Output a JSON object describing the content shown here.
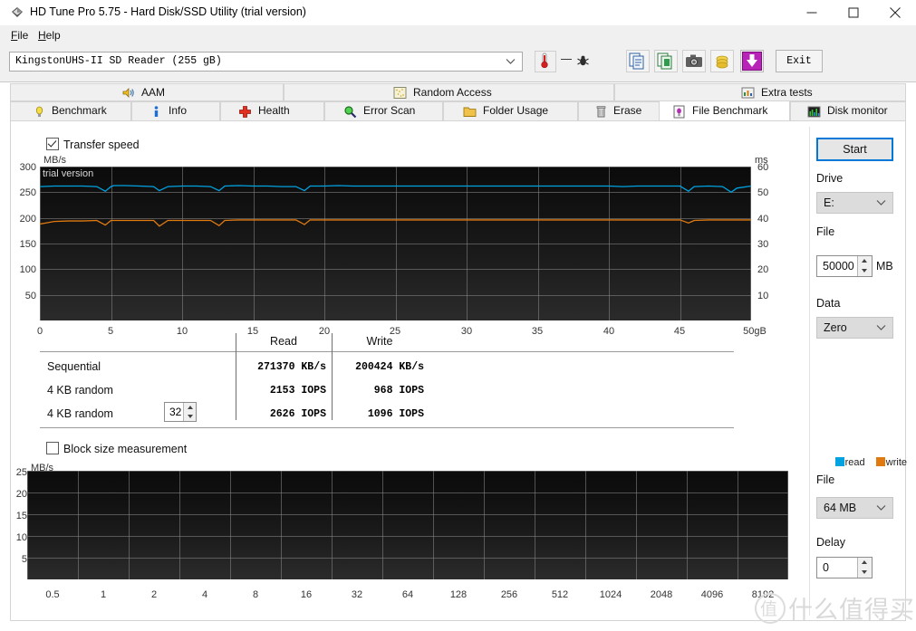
{
  "window": {
    "title": "HD Tune Pro 5.75 - Hard Disk/SSD Utility (trial version)",
    "minimize": "minimize-icon",
    "maximize": "maximize-icon",
    "close": "close-icon"
  },
  "menu": {
    "items": [
      "File",
      "Help"
    ]
  },
  "toolbar": {
    "drive_value": "KingstonUHS-II SD Reader  (255 gB)",
    "temperature": "—",
    "exit_label": "Exit",
    "buttons": [
      "copy-icon",
      "copy-excel-icon",
      "camera-icon",
      "folder-coins-icon",
      "download-icon"
    ]
  },
  "tabs_top": [
    {
      "label": "AAM",
      "icon": "speaker-icon"
    },
    {
      "label": "Random Access",
      "icon": "random-access-icon"
    },
    {
      "label": "Extra tests",
      "icon": "chart-icon"
    }
  ],
  "tabs_bottom": [
    {
      "label": "Benchmark",
      "icon": "bulb-icon",
      "active": false
    },
    {
      "label": "Info",
      "icon": "info-icon",
      "active": false
    },
    {
      "label": "Health",
      "icon": "cross-icon",
      "active": false
    },
    {
      "label": "Error Scan",
      "icon": "magnifier-icon",
      "active": false
    },
    {
      "label": "Folder Usage",
      "icon": "folder-icon",
      "active": false
    },
    {
      "label": "Erase",
      "icon": "trash-icon",
      "active": false
    },
    {
      "label": "File Benchmark",
      "icon": "file-benchmark-icon",
      "active": true
    },
    {
      "label": "Disk monitor",
      "icon": "monitor-chart-icon",
      "active": false
    }
  ],
  "transfer_speed": {
    "checkbox_label": "Transfer speed",
    "checked": true,
    "trial_tag": "trial version"
  },
  "block_size": {
    "checkbox_label": "Block size measurement",
    "checked": false
  },
  "legend": {
    "read": "read",
    "write": "write",
    "read_color": "#00a2e0",
    "write_color": "#e07a10"
  },
  "results": {
    "columns": [
      "",
      "Read",
      "Write"
    ],
    "rows": [
      {
        "label": "Sequential",
        "read": "271370 KB/s",
        "write": "200424 KB/s"
      },
      {
        "label": "4 KB random",
        "read": "2153 IOPS",
        "write": "968 IOPS"
      },
      {
        "label": "4 KB random",
        "read": "2626 IOPS",
        "write": "1096 IOPS",
        "queue_depth": "32"
      }
    ]
  },
  "right_panel": {
    "start_label": "Start",
    "drive_label": "Drive",
    "drive_value": "E:",
    "file_label": "File",
    "file_value": "50000",
    "file_unit": "MB",
    "data_label": "Data",
    "data_value": "Zero"
  },
  "right_panel_bottom": {
    "file_label": "File",
    "file_value": "64 MB",
    "delay_label": "Delay",
    "delay_value": "0"
  },
  "watermark": {
    "text": "什么值得买",
    "mark": "值"
  },
  "chart_data": [
    {
      "type": "line",
      "title": "Transfer speed",
      "ylabel": "MB/s",
      "y2label": "ms",
      "xlabel": "",
      "xlim": [
        0,
        50
      ],
      "ylim": [
        0,
        300
      ],
      "y2lim": [
        0,
        60
      ],
      "grid": true,
      "xticks": [
        "0",
        "5",
        "10",
        "15",
        "20",
        "25",
        "30",
        "35",
        "40",
        "45",
        "50gB"
      ],
      "yticks": [
        "50",
        "100",
        "150",
        "200",
        "250",
        "300"
      ],
      "y2ticks": [
        "10",
        "20",
        "30",
        "40",
        "50",
        "60"
      ],
      "legend": [
        "read",
        "write"
      ],
      "series": [
        {
          "name": "read",
          "color": "#00a2e0",
          "x": [
            0,
            1,
            2,
            3,
            4,
            4.6,
            5,
            5.2,
            6,
            7,
            8,
            8.4,
            9,
            10,
            11,
            12,
            12.6,
            13,
            14,
            15,
            16,
            17,
            18,
            18.6,
            19,
            20,
            21,
            22,
            23,
            24,
            25,
            26,
            27,
            28,
            29,
            30,
            31,
            32,
            33,
            34,
            35,
            36,
            37,
            38,
            39,
            40,
            41,
            42,
            43,
            44,
            45,
            45.6,
            46,
            47,
            48,
            48.6,
            49,
            50
          ],
          "y": [
            261,
            262,
            262,
            262,
            261,
            252,
            261,
            263,
            263,
            262,
            261,
            253,
            261,
            262,
            262,
            261,
            253,
            262,
            263,
            262,
            262,
            261,
            261,
            253,
            262,
            262,
            263,
            262,
            262,
            262,
            262,
            262,
            262,
            262,
            262,
            262,
            262,
            262,
            262,
            262,
            262,
            262,
            262,
            262,
            262,
            262,
            261,
            262,
            262,
            262,
            262,
            252,
            261,
            262,
            261,
            250,
            258,
            262
          ]
        },
        {
          "name": "write",
          "color": "#e07a10",
          "x": [
            0,
            0.4,
            1,
            2,
            3,
            4,
            4.6,
            5,
            6,
            7,
            8,
            8.4,
            9,
            10,
            11,
            12,
            12.6,
            13,
            14,
            15,
            16,
            17,
            18,
            18.6,
            19,
            20,
            21,
            22,
            23,
            24,
            25,
            26,
            27,
            28,
            29,
            30,
            31,
            32,
            33,
            34,
            35,
            36,
            37,
            38,
            39,
            40,
            41,
            42,
            43,
            44,
            45,
            45.6,
            46,
            47,
            48,
            49,
            50
          ],
          "y": [
            188,
            190,
            193,
            194,
            194,
            195,
            186,
            195,
            195,
            195,
            195,
            184,
            195,
            195,
            195,
            195,
            185,
            195,
            196,
            196,
            196,
            196,
            196,
            187,
            196,
            196,
            196,
            196,
            196,
            196,
            196,
            196,
            196,
            196,
            196,
            196,
            196,
            196,
            196,
            196,
            196,
            196,
            196,
            196,
            196,
            196,
            196,
            196,
            196,
            196,
            196,
            190,
            195,
            196,
            196,
            196,
            196
          ]
        }
      ]
    },
    {
      "type": "line",
      "title": "Block size measurement",
      "ylabel": "MB/s",
      "ylim": [
        0,
        25
      ],
      "yticks": [
        "5",
        "10",
        "15",
        "20",
        "25"
      ],
      "xticks": [
        "0.5",
        "1",
        "2",
        "4",
        "8",
        "16",
        "32",
        "64",
        "128",
        "256",
        "512",
        "1024",
        "2048",
        "4096",
        "8192"
      ],
      "grid": true,
      "legend": [
        "read",
        "write"
      ],
      "series": [
        {
          "name": "read",
          "color": "#00a2e0",
          "values": []
        },
        {
          "name": "write",
          "color": "#e07a10",
          "values": []
        }
      ]
    }
  ]
}
